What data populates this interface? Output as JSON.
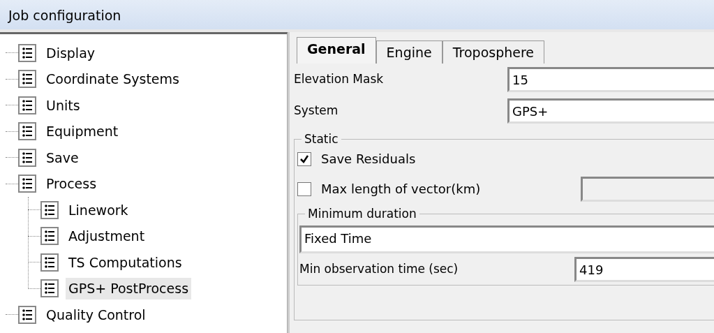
{
  "window": {
    "title": "Job configuration"
  },
  "tree": [
    {
      "label": "Display",
      "selected": false
    },
    {
      "label": "Coordinate Systems",
      "selected": false
    },
    {
      "label": "Units",
      "selected": false
    },
    {
      "label": "Equipment",
      "selected": false
    },
    {
      "label": "Save",
      "selected": false
    },
    {
      "label": "Process",
      "selected": false,
      "expanded": true,
      "children": [
        {
          "label": "Linework",
          "selected": false
        },
        {
          "label": "Adjustment",
          "selected": false
        },
        {
          "label": "TS Computations",
          "selected": false
        },
        {
          "label": "GPS+ PostProcess",
          "selected": true
        }
      ]
    },
    {
      "label": "Quality Control",
      "selected": false
    }
  ],
  "tabs": [
    {
      "label": "General",
      "selected": true
    },
    {
      "label": "Engine",
      "selected": false
    },
    {
      "label": "Troposphere",
      "selected": false
    }
  ],
  "fields": [
    {
      "label": "Elevation Mask",
      "value": "15"
    },
    {
      "label": "System",
      "value": "GPS+"
    }
  ],
  "static": {
    "title": "Static",
    "options": [
      {
        "label": "Save Residuals",
        "checked": true
      },
      {
        "label": "Max length of vector(km)",
        "checked": false,
        "field": {
          "disabled": true
        }
      }
    ],
    "minimum_duration": {
      "title": "Minimum duration",
      "mode": "Fixed Time",
      "fields": [
        {
          "label": "Min observation time (sec)",
          "value": "419"
        }
      ]
    }
  }
}
